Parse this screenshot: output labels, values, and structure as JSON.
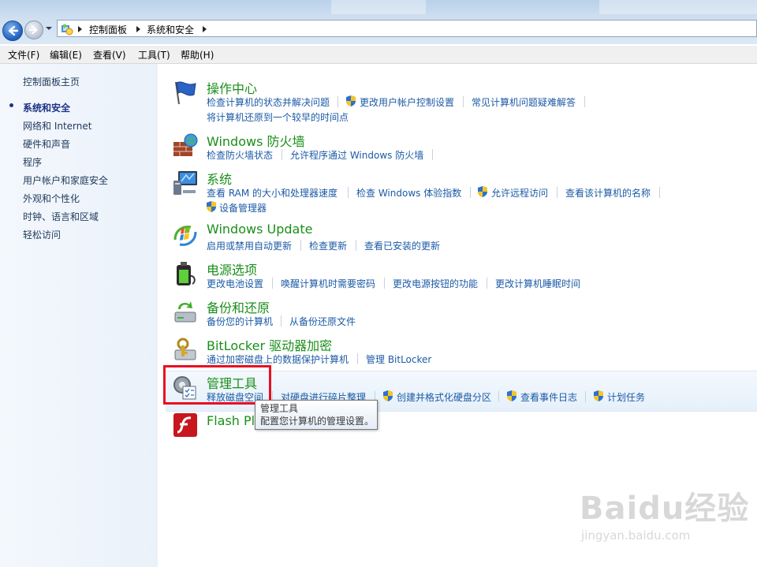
{
  "breadcrumb": [
    "控制面板",
    "系统和安全"
  ],
  "menu": [
    "文件(F)",
    "编辑(E)",
    "查看(V)",
    "工具(T)",
    "帮助(H)"
  ],
  "sidebar": {
    "home": "控制面板主页",
    "current": "系统和安全",
    "items": [
      "网络和 Internet",
      "硬件和声音",
      "程序",
      "用户帐户和家庭安全",
      "外观和个性化",
      "时钟、语言和区域",
      "轻松访问"
    ]
  },
  "categories": [
    {
      "title": "操作中心",
      "icon": "flag-icon",
      "links": [
        "检查计算机的状态并解决问题",
        "更改用户帐户控制设置",
        "常见计算机问题疑难解答",
        "将计算机还原到一个较早的时间点"
      ]
    },
    {
      "title": "Windows 防火墙",
      "icon": "firewall-icon",
      "links": [
        "检查防火墙状态",
        "允许程序通过 Windows 防火墙"
      ]
    },
    {
      "title": "系统",
      "icon": "computer-icon",
      "links": [
        "查看 RAM 的大小和处理器速度",
        "检查 Windows 体验指数",
        "允许远程访问",
        "查看该计算机的名称",
        "设备管理器"
      ]
    },
    {
      "title": "Windows Update",
      "icon": "windows-update-icon",
      "links": [
        "启用或禁用自动更新",
        "检查更新",
        "查看已安装的更新"
      ]
    },
    {
      "title": "电源选项",
      "icon": "battery-icon",
      "links": [
        "更改电池设置",
        "唤醒计算机时需要密码",
        "更改电源按钮的功能",
        "更改计算机睡眠时间"
      ]
    },
    {
      "title": "备份和还原",
      "icon": "backup-icon",
      "links": [
        "备份您的计算机",
        "从备份还原文件"
      ]
    },
    {
      "title": "BitLocker 驱动器加密",
      "icon": "bitlocker-icon",
      "links": [
        "通过加密磁盘上的数据保护计算机",
        "管理 BitLocker"
      ]
    },
    {
      "title": "管理工具",
      "icon": "admin-tools-icon",
      "links": [
        "释放磁盘空间",
        "对硬盘进行碎片整理",
        "创建并格式化硬盘分区",
        "查看事件日志",
        "计划任务"
      ]
    },
    {
      "title": "Flash Pla",
      "icon": "flash-icon",
      "links": []
    }
  ],
  "tooltip": {
    "title": "管理工具",
    "desc": "配置您计算机的管理设置。"
  },
  "watermark": {
    "brand": "Baidu经验",
    "url": "jingyan.baidu.com"
  },
  "colors": {
    "title_green": "#1a8f1a",
    "link_blue": "#1b5aa6",
    "highlight_red": "#e81021"
  }
}
